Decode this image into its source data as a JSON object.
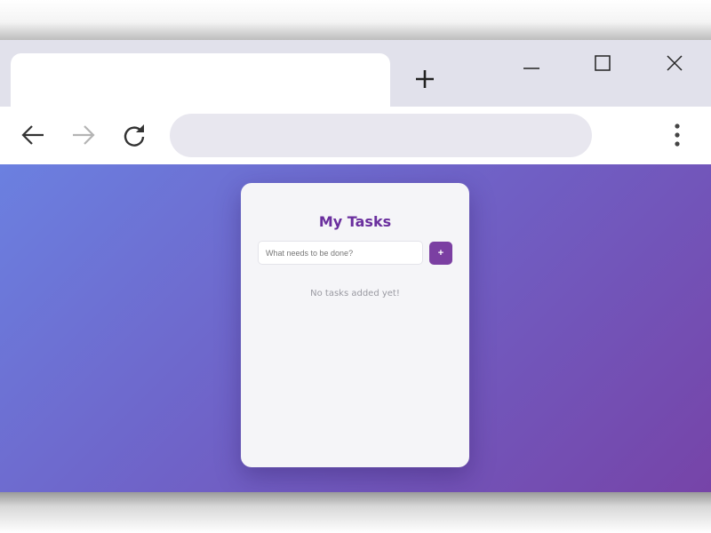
{
  "browser": {
    "tab": {
      "title": ""
    },
    "new_tab_label": "+",
    "address_bar": {
      "value": "",
      "placeholder": ""
    },
    "icons": {
      "back": "back-arrow-icon",
      "forward": "forward-arrow-icon",
      "reload": "reload-icon",
      "menu": "kebab-menu-icon",
      "minimize": "minimize-icon",
      "maximize": "maximize-icon",
      "close": "close-icon"
    },
    "forward_enabled": false
  },
  "app": {
    "title": "My Tasks",
    "input": {
      "value": "",
      "placeholder": "What needs to be done?"
    },
    "add_button_label": "+",
    "empty_message": "No tasks added yet!",
    "tasks": []
  },
  "colors": {
    "gradient_start": "#6b80e0",
    "gradient_end": "#7644a8",
    "accent": "#7b3fa2",
    "title": "#6a2f9e",
    "card_bg": "#f5f5f8",
    "empty_text": "#9a9aa2"
  }
}
